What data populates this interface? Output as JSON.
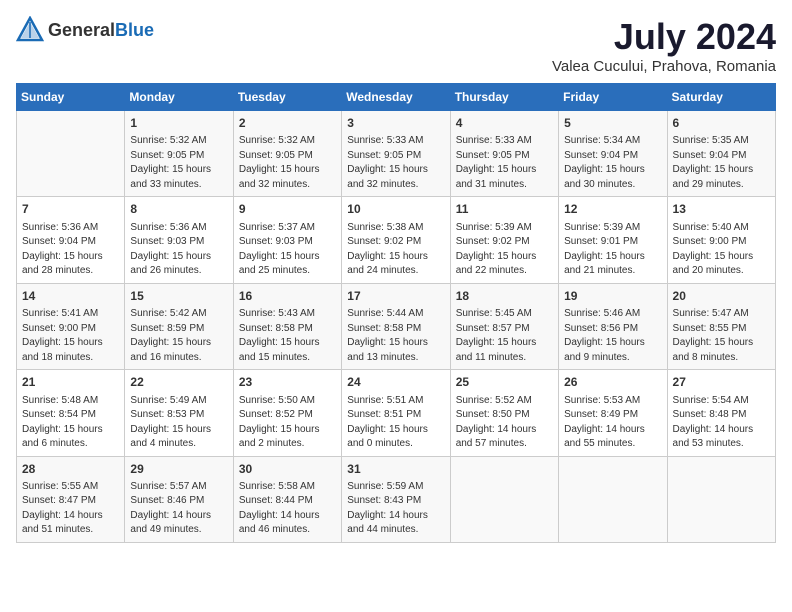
{
  "header": {
    "logo_general": "General",
    "logo_blue": "Blue",
    "month_title": "July 2024",
    "location": "Valea Cucului, Prahova, Romania"
  },
  "days_of_week": [
    "Sunday",
    "Monday",
    "Tuesday",
    "Wednesday",
    "Thursday",
    "Friday",
    "Saturday"
  ],
  "weeks": [
    [
      {
        "day": "",
        "info": ""
      },
      {
        "day": "1",
        "info": "Sunrise: 5:32 AM\nSunset: 9:05 PM\nDaylight: 15 hours\nand 33 minutes."
      },
      {
        "day": "2",
        "info": "Sunrise: 5:32 AM\nSunset: 9:05 PM\nDaylight: 15 hours\nand 32 minutes."
      },
      {
        "day": "3",
        "info": "Sunrise: 5:33 AM\nSunset: 9:05 PM\nDaylight: 15 hours\nand 32 minutes."
      },
      {
        "day": "4",
        "info": "Sunrise: 5:33 AM\nSunset: 9:05 PM\nDaylight: 15 hours\nand 31 minutes."
      },
      {
        "day": "5",
        "info": "Sunrise: 5:34 AM\nSunset: 9:04 PM\nDaylight: 15 hours\nand 30 minutes."
      },
      {
        "day": "6",
        "info": "Sunrise: 5:35 AM\nSunset: 9:04 PM\nDaylight: 15 hours\nand 29 minutes."
      }
    ],
    [
      {
        "day": "7",
        "info": "Sunrise: 5:36 AM\nSunset: 9:04 PM\nDaylight: 15 hours\nand 28 minutes."
      },
      {
        "day": "8",
        "info": "Sunrise: 5:36 AM\nSunset: 9:03 PM\nDaylight: 15 hours\nand 26 minutes."
      },
      {
        "day": "9",
        "info": "Sunrise: 5:37 AM\nSunset: 9:03 PM\nDaylight: 15 hours\nand 25 minutes."
      },
      {
        "day": "10",
        "info": "Sunrise: 5:38 AM\nSunset: 9:02 PM\nDaylight: 15 hours\nand 24 minutes."
      },
      {
        "day": "11",
        "info": "Sunrise: 5:39 AM\nSunset: 9:02 PM\nDaylight: 15 hours\nand 22 minutes."
      },
      {
        "day": "12",
        "info": "Sunrise: 5:39 AM\nSunset: 9:01 PM\nDaylight: 15 hours\nand 21 minutes."
      },
      {
        "day": "13",
        "info": "Sunrise: 5:40 AM\nSunset: 9:00 PM\nDaylight: 15 hours\nand 20 minutes."
      }
    ],
    [
      {
        "day": "14",
        "info": "Sunrise: 5:41 AM\nSunset: 9:00 PM\nDaylight: 15 hours\nand 18 minutes."
      },
      {
        "day": "15",
        "info": "Sunrise: 5:42 AM\nSunset: 8:59 PM\nDaylight: 15 hours\nand 16 minutes."
      },
      {
        "day": "16",
        "info": "Sunrise: 5:43 AM\nSunset: 8:58 PM\nDaylight: 15 hours\nand 15 minutes."
      },
      {
        "day": "17",
        "info": "Sunrise: 5:44 AM\nSunset: 8:58 PM\nDaylight: 15 hours\nand 13 minutes."
      },
      {
        "day": "18",
        "info": "Sunrise: 5:45 AM\nSunset: 8:57 PM\nDaylight: 15 hours\nand 11 minutes."
      },
      {
        "day": "19",
        "info": "Sunrise: 5:46 AM\nSunset: 8:56 PM\nDaylight: 15 hours\nand 9 minutes."
      },
      {
        "day": "20",
        "info": "Sunrise: 5:47 AM\nSunset: 8:55 PM\nDaylight: 15 hours\nand 8 minutes."
      }
    ],
    [
      {
        "day": "21",
        "info": "Sunrise: 5:48 AM\nSunset: 8:54 PM\nDaylight: 15 hours\nand 6 minutes."
      },
      {
        "day": "22",
        "info": "Sunrise: 5:49 AM\nSunset: 8:53 PM\nDaylight: 15 hours\nand 4 minutes."
      },
      {
        "day": "23",
        "info": "Sunrise: 5:50 AM\nSunset: 8:52 PM\nDaylight: 15 hours\nand 2 minutes."
      },
      {
        "day": "24",
        "info": "Sunrise: 5:51 AM\nSunset: 8:51 PM\nDaylight: 15 hours\nand 0 minutes."
      },
      {
        "day": "25",
        "info": "Sunrise: 5:52 AM\nSunset: 8:50 PM\nDaylight: 14 hours\nand 57 minutes."
      },
      {
        "day": "26",
        "info": "Sunrise: 5:53 AM\nSunset: 8:49 PM\nDaylight: 14 hours\nand 55 minutes."
      },
      {
        "day": "27",
        "info": "Sunrise: 5:54 AM\nSunset: 8:48 PM\nDaylight: 14 hours\nand 53 minutes."
      }
    ],
    [
      {
        "day": "28",
        "info": "Sunrise: 5:55 AM\nSunset: 8:47 PM\nDaylight: 14 hours\nand 51 minutes."
      },
      {
        "day": "29",
        "info": "Sunrise: 5:57 AM\nSunset: 8:46 PM\nDaylight: 14 hours\nand 49 minutes."
      },
      {
        "day": "30",
        "info": "Sunrise: 5:58 AM\nSunset: 8:44 PM\nDaylight: 14 hours\nand 46 minutes."
      },
      {
        "day": "31",
        "info": "Sunrise: 5:59 AM\nSunset: 8:43 PM\nDaylight: 14 hours\nand 44 minutes."
      },
      {
        "day": "",
        "info": ""
      },
      {
        "day": "",
        "info": ""
      },
      {
        "day": "",
        "info": ""
      }
    ]
  ]
}
